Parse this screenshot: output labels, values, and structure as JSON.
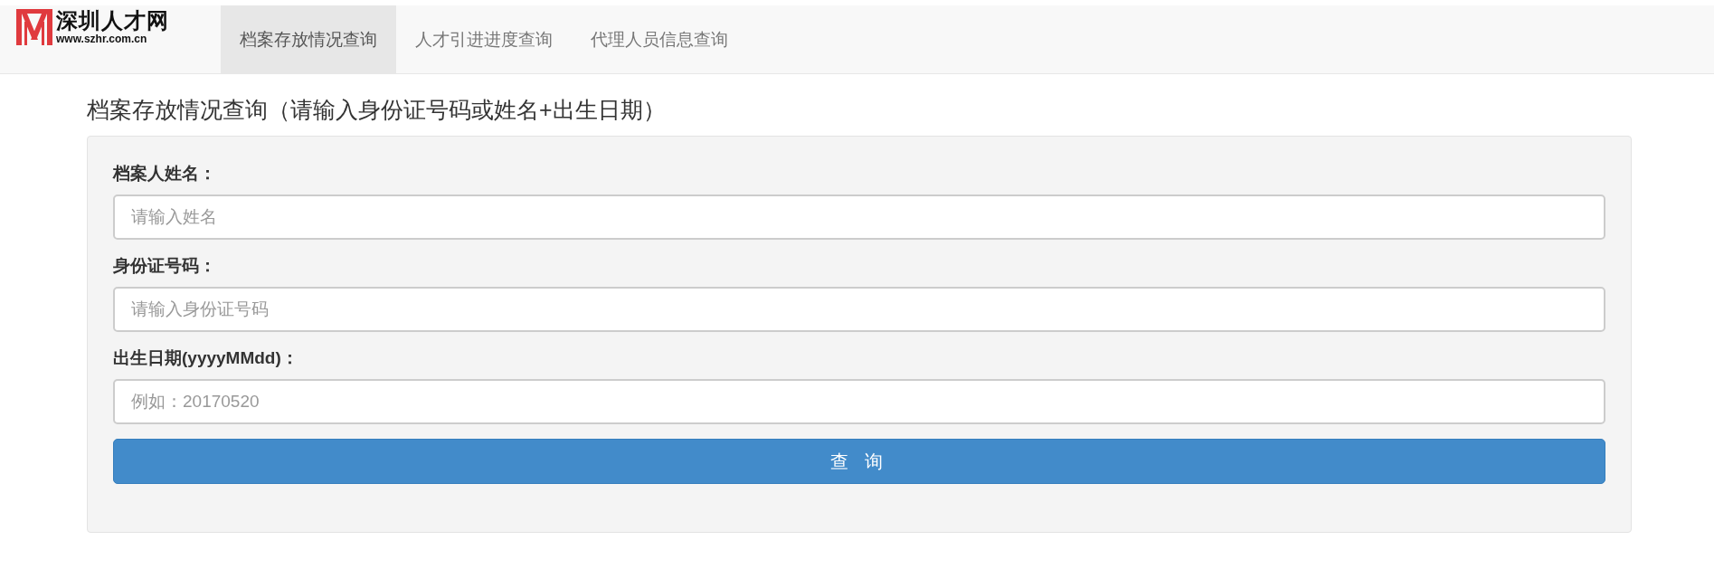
{
  "logo": {
    "name": "深圳人才网",
    "url": "www.szhr.com.cn"
  },
  "tabs": [
    {
      "label": "档案存放情况查询",
      "selected": true
    },
    {
      "label": "人才引进进度查询",
      "selected": false
    },
    {
      "label": "代理人员信息查询",
      "selected": false
    }
  ],
  "heading": "档案存放情况查询（请输入身份证号码或姓名+出生日期）",
  "fields": [
    {
      "label": "档案人姓名：",
      "placeholder": "请输入姓名"
    },
    {
      "label": "身份证号码：",
      "placeholder": "请输入身份证号码"
    },
    {
      "label": "出生日期(yyyyMMdd)：",
      "placeholder": "例如：20170520"
    }
  ],
  "submit": "查 询"
}
